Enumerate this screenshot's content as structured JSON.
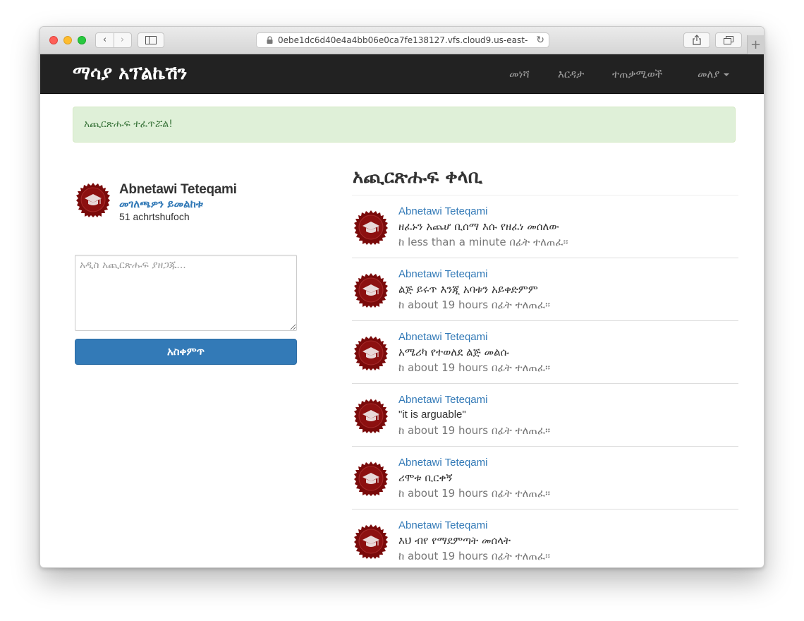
{
  "browser": {
    "url": "0ebe1dc6d40e4a4bb06e0ca7fe138127.vfs.cloud9.us-east-",
    "back_glyph": "‹",
    "forward_glyph": "›",
    "new_tab_glyph": "+",
    "reload_glyph": "↻"
  },
  "navbar": {
    "brand": "ማሳያ አፕልኬሽን",
    "links": [
      "መነሻ",
      "እርዳታ",
      "ተጠቃሚወች",
      "መለያ"
    ]
  },
  "alert": {
    "text": "አጪርጽሑፍ ተፈጥሯል!"
  },
  "user_info": {
    "name": "Abnetawi Teteqami",
    "profile_link": "መገለጫዎን ይመልከቱ",
    "count": "51 achrtshufoch"
  },
  "post_form": {
    "placeholder": "አዲስ አጪርጽሑፍ ያዘጋጁ...",
    "submit_label": "አስቀምጥ"
  },
  "feed": {
    "title": "አጪርጽሑፍ ቀላቢ",
    "items": [
      {
        "user": "Abnetawi Teteqami",
        "content": "ዘፈኑን አጨሆ ቢሰማ እሱ የዘፈነ መሰለው",
        "time": "ከ less than a minute በፊት ተለጠፈ።"
      },
      {
        "user": "Abnetawi Teteqami",
        "content": "ልጅ ይሩጥ እንጂ አባቱን አይቀድምም",
        "time": "ከ about 19 hours በፊት ተለጠፈ።"
      },
      {
        "user": "Abnetawi Teteqami",
        "content": "አሜሪካ የተወለደ ልጅ መልሱ",
        "time": "ከ about 19 hours በፊት ተለጠፈ።"
      },
      {
        "user": "Abnetawi Teteqami",
        "content": "\"it is arguable\"",
        "time": "ከ about 19 hours በፊት ተለጠፈ።"
      },
      {
        "user": "Abnetawi Teteqami",
        "content": "ሪሞቱ ቢርቀኝ",
        "time": "ከ about 19 hours በፊት ተለጠፈ።"
      },
      {
        "user": "Abnetawi Teteqami",
        "content": "እህ ብየ የማደምጣት መሰላት",
        "time": "ከ about 19 hours በፊት ተለጠፈ።"
      }
    ]
  },
  "colors": {
    "navbar_bg": "#222222",
    "link": "#337ab7",
    "alert_bg": "#dff0d8",
    "alert_text": "#3c763d",
    "avatar_badge": "#7a0a0a"
  }
}
